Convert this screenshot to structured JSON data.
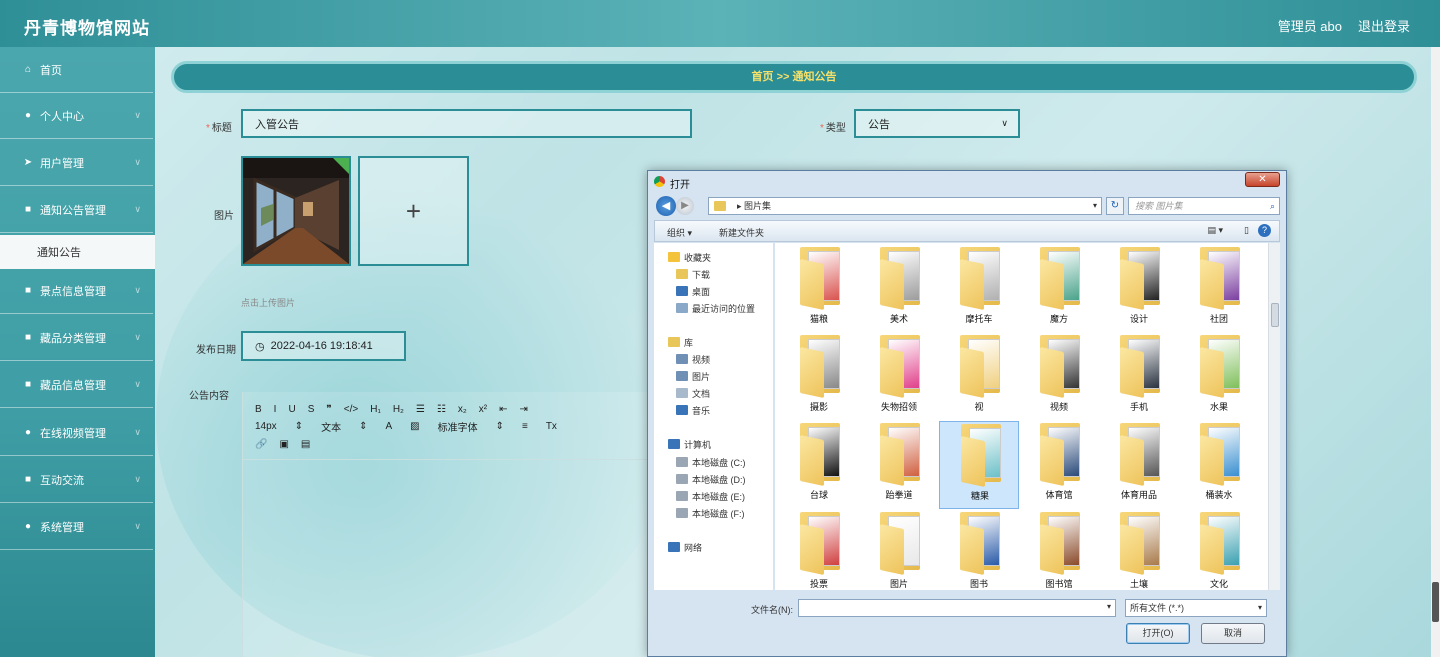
{
  "header": {
    "site_title": "丹青博物馆网站",
    "admin": "管理员 abo",
    "logout": "退出登录"
  },
  "sidebar": {
    "items": [
      {
        "label": "首页",
        "icon": "home-icon",
        "glyph": "⌂"
      },
      {
        "label": "个人中心",
        "icon": "user-icon",
        "glyph": "●"
      },
      {
        "label": "用户管理",
        "icon": "send-icon",
        "glyph": "➤"
      },
      {
        "label": "通知公告管理",
        "icon": "grid-icon",
        "glyph": "■"
      },
      {
        "label": "景点信息管理",
        "icon": "grid-icon",
        "glyph": "■"
      },
      {
        "label": "藏品分类管理",
        "icon": "grid-icon",
        "glyph": "■"
      },
      {
        "label": "藏品信息管理",
        "icon": "grid-icon",
        "glyph": "■"
      },
      {
        "label": "在线视频管理",
        "icon": "person-icon",
        "glyph": "●"
      },
      {
        "label": "互动交流",
        "icon": "grid-icon",
        "glyph": "■"
      },
      {
        "label": "系统管理",
        "icon": "pin-icon",
        "glyph": "●"
      }
    ],
    "sub_item": "通知公告",
    "chevron": "∨"
  },
  "breadcrumb": "首页 >> 通知公告",
  "form": {
    "title_label": "标题",
    "title_value": "入管公告",
    "type_label": "类型",
    "type_value": "公告",
    "type_chevron": "∨",
    "image_label": "图片",
    "upload_plus": "+",
    "upload_hint": "点击上传图片",
    "date_label": "发布日期",
    "date_value": "2022-04-16 19:18:41",
    "date_icon": "◷",
    "content_label": "公告内容",
    "required_mark": "*"
  },
  "editor_toolbar": {
    "row1": [
      "B",
      "I",
      "U",
      "S",
      "❞",
      "</>",
      "H₁",
      "H₂",
      "☰",
      "☷",
      "x₂",
      "x²",
      "⇤",
      "⇥"
    ],
    "row2": [
      "14px",
      "⇕",
      "文本",
      "⇕",
      "A",
      "▨",
      "标准字体",
      "⇕",
      "≡",
      "Tx"
    ],
    "row3": [
      "🔗",
      "▣",
      "▤"
    ]
  },
  "dialog": {
    "title": "打开",
    "close": "✕",
    "back": "◀",
    "forward": "▶",
    "path": "▸  图片集",
    "refresh": "↻",
    "search_placeholder": "搜索 图片集",
    "search_icon": "⌕",
    "organize": "组织 ▾",
    "new_folder": "新建文件夹",
    "view": "▤ ▾",
    "pane": "▯",
    "help": "?",
    "tree": [
      {
        "label": "收藏夹",
        "color": "#f3c33c",
        "indent": 0
      },
      {
        "label": "下载",
        "color": "#e8c65a",
        "indent": 1
      },
      {
        "label": "桌面",
        "color": "#3a74b8",
        "indent": 1
      },
      {
        "label": "最近访问的位置",
        "color": "#8aa8c8",
        "indent": 1
      },
      {
        "label": "库",
        "color": "#e8c65a",
        "indent": 0
      },
      {
        "label": "视频",
        "color": "#6f8fb5",
        "indent": 1
      },
      {
        "label": "图片",
        "color": "#6f8fb5",
        "indent": 1
      },
      {
        "label": "文档",
        "color": "#a9b9cc",
        "indent": 1
      },
      {
        "label": "音乐",
        "color": "#3a74b8",
        "indent": 1
      },
      {
        "label": "计算机",
        "color": "#3a74b8",
        "indent": 0
      },
      {
        "label": "本地磁盘 (C:)",
        "color": "#9aa6b3",
        "indent": 1
      },
      {
        "label": "本地磁盘 (D:)",
        "color": "#9aa6b3",
        "indent": 1
      },
      {
        "label": "本地磁盘 (E:)",
        "color": "#9aa6b3",
        "indent": 1
      },
      {
        "label": "本地磁盘 (F:)",
        "color": "#9aa6b3",
        "indent": 1
      },
      {
        "label": "网络",
        "color": "#3a74b8",
        "indent": 0
      }
    ],
    "folders": [
      {
        "name": "猫粮",
        "tint": "#d9534f"
      },
      {
        "name": "美术",
        "tint": "#9c9c9c"
      },
      {
        "name": "摩托车",
        "tint": "#b0b0b0"
      },
      {
        "name": "魔方",
        "tint": "#4aa38a"
      },
      {
        "name": "设计",
        "tint": "#222222"
      },
      {
        "name": "社团",
        "tint": "#7b3fa0"
      },
      {
        "name": "摄影",
        "tint": "#888888"
      },
      {
        "name": "失物招领",
        "tint": "#e0408a"
      },
      {
        "name": "视",
        "tint": "#f0d080"
      },
      {
        "name": "视频",
        "tint": "#333333"
      },
      {
        "name": "手机",
        "tint": "#2a3340"
      },
      {
        "name": "水果",
        "tint": "#7fbf5a"
      },
      {
        "name": "台球",
        "tint": "#111111"
      },
      {
        "name": "跆拳道",
        "tint": "#d06040"
      },
      {
        "name": "糖果",
        "tint": "#6cc0c8"
      },
      {
        "name": "体育馆",
        "tint": "#2a4a7a"
      },
      {
        "name": "体育用品",
        "tint": "#555555"
      },
      {
        "name": "桶装水",
        "tint": "#3a8fd0"
      },
      {
        "name": "投票",
        "tint": "#d04040"
      },
      {
        "name": "图片",
        "tint": "#e8e8e8"
      },
      {
        "name": "图书",
        "tint": "#2a5ba8"
      },
      {
        "name": "图书馆",
        "tint": "#8a4a2a"
      },
      {
        "name": "土壤",
        "tint": "#a87a4a"
      },
      {
        "name": "文化",
        "tint": "#3aa0b0"
      }
    ],
    "selected_folder": "糖果",
    "filename_label": "文件名(N):",
    "filename_value": "",
    "filetype": "所有文件 (*.*)",
    "open_button": "打开(O)",
    "cancel_button": "取消",
    "drop": "▾"
  }
}
